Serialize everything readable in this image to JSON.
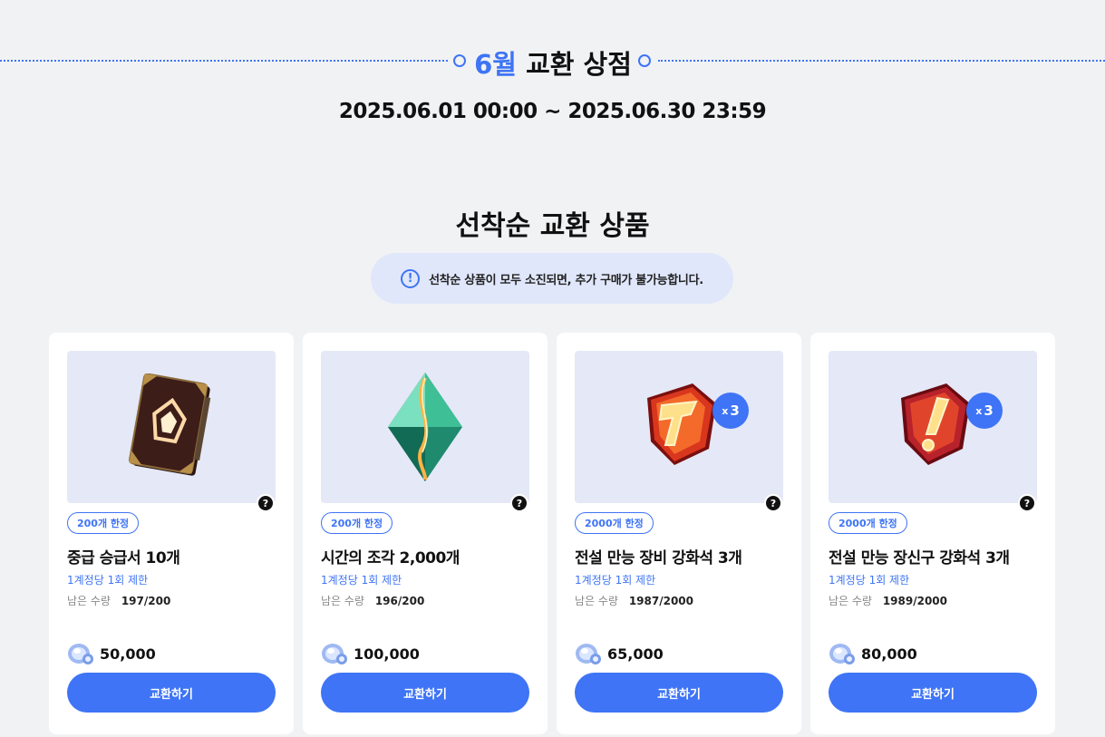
{
  "header": {
    "month": "6월",
    "title": "교환 상점",
    "period": "2025.06.01 00:00 ~ 2025.06.30 23:59"
  },
  "section": {
    "title": "선착순 교환 상품",
    "notice_icon": "!",
    "notice": "선착순 상품이 모두 소진되면, 추가 구매가 불가능합니다."
  },
  "colors": {
    "accent": "#3e74f5",
    "background": "#f1f2f4",
    "thumb_bg": "#e5e8f6"
  },
  "items": [
    {
      "icon": "book-icon",
      "badge": "200개 한정",
      "name": "중급 승급서 10개",
      "limit": "1계정당 1회 제한",
      "remain_label": "남은 수량",
      "remain": "197/200",
      "price": "50,000",
      "button": "교환하기",
      "help": "?"
    },
    {
      "icon": "crystal-icon",
      "badge": "200개 한정",
      "name": "시간의 조각 2,000개",
      "limit": "1계정당 1회 제한",
      "remain_label": "남은 수량",
      "remain": "196/200",
      "price": "100,000",
      "button": "교환하기",
      "help": "?"
    },
    {
      "icon": "equipment-stone-icon",
      "badge": "2000개 한정",
      "name": "전설 만능 장비 강화석 3개",
      "limit": "1계정당 1회 제한",
      "remain_label": "남은 수량",
      "remain": "1987/2000",
      "price": "65,000",
      "button": "교환하기",
      "help": "?",
      "multiplier_x": "x",
      "multiplier": "3"
    },
    {
      "icon": "accessory-stone-icon",
      "badge": "2000개 한정",
      "name": "전설 만능 장신구 강화석 3개",
      "limit": "1계정당 1회 제한",
      "remain_label": "남은 수량",
      "remain": "1989/2000",
      "price": "80,000",
      "button": "교환하기",
      "help": "?",
      "multiplier_x": "x",
      "multiplier": "3"
    }
  ]
}
